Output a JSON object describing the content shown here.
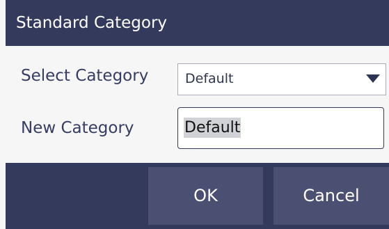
{
  "dialog": {
    "title": "Standard Category"
  },
  "form": {
    "select_label": "Select Category",
    "select_value": "Default",
    "new_label": "New Category",
    "new_value": "Default"
  },
  "buttons": {
    "ok": "OK",
    "cancel": "Cancel"
  },
  "colors": {
    "titlebar": "#333a5c",
    "button": "#4b4f71",
    "label_text": "#363d63",
    "background": "#f6f6f7"
  },
  "icons": {
    "dropdown": "chevron-down-icon"
  }
}
